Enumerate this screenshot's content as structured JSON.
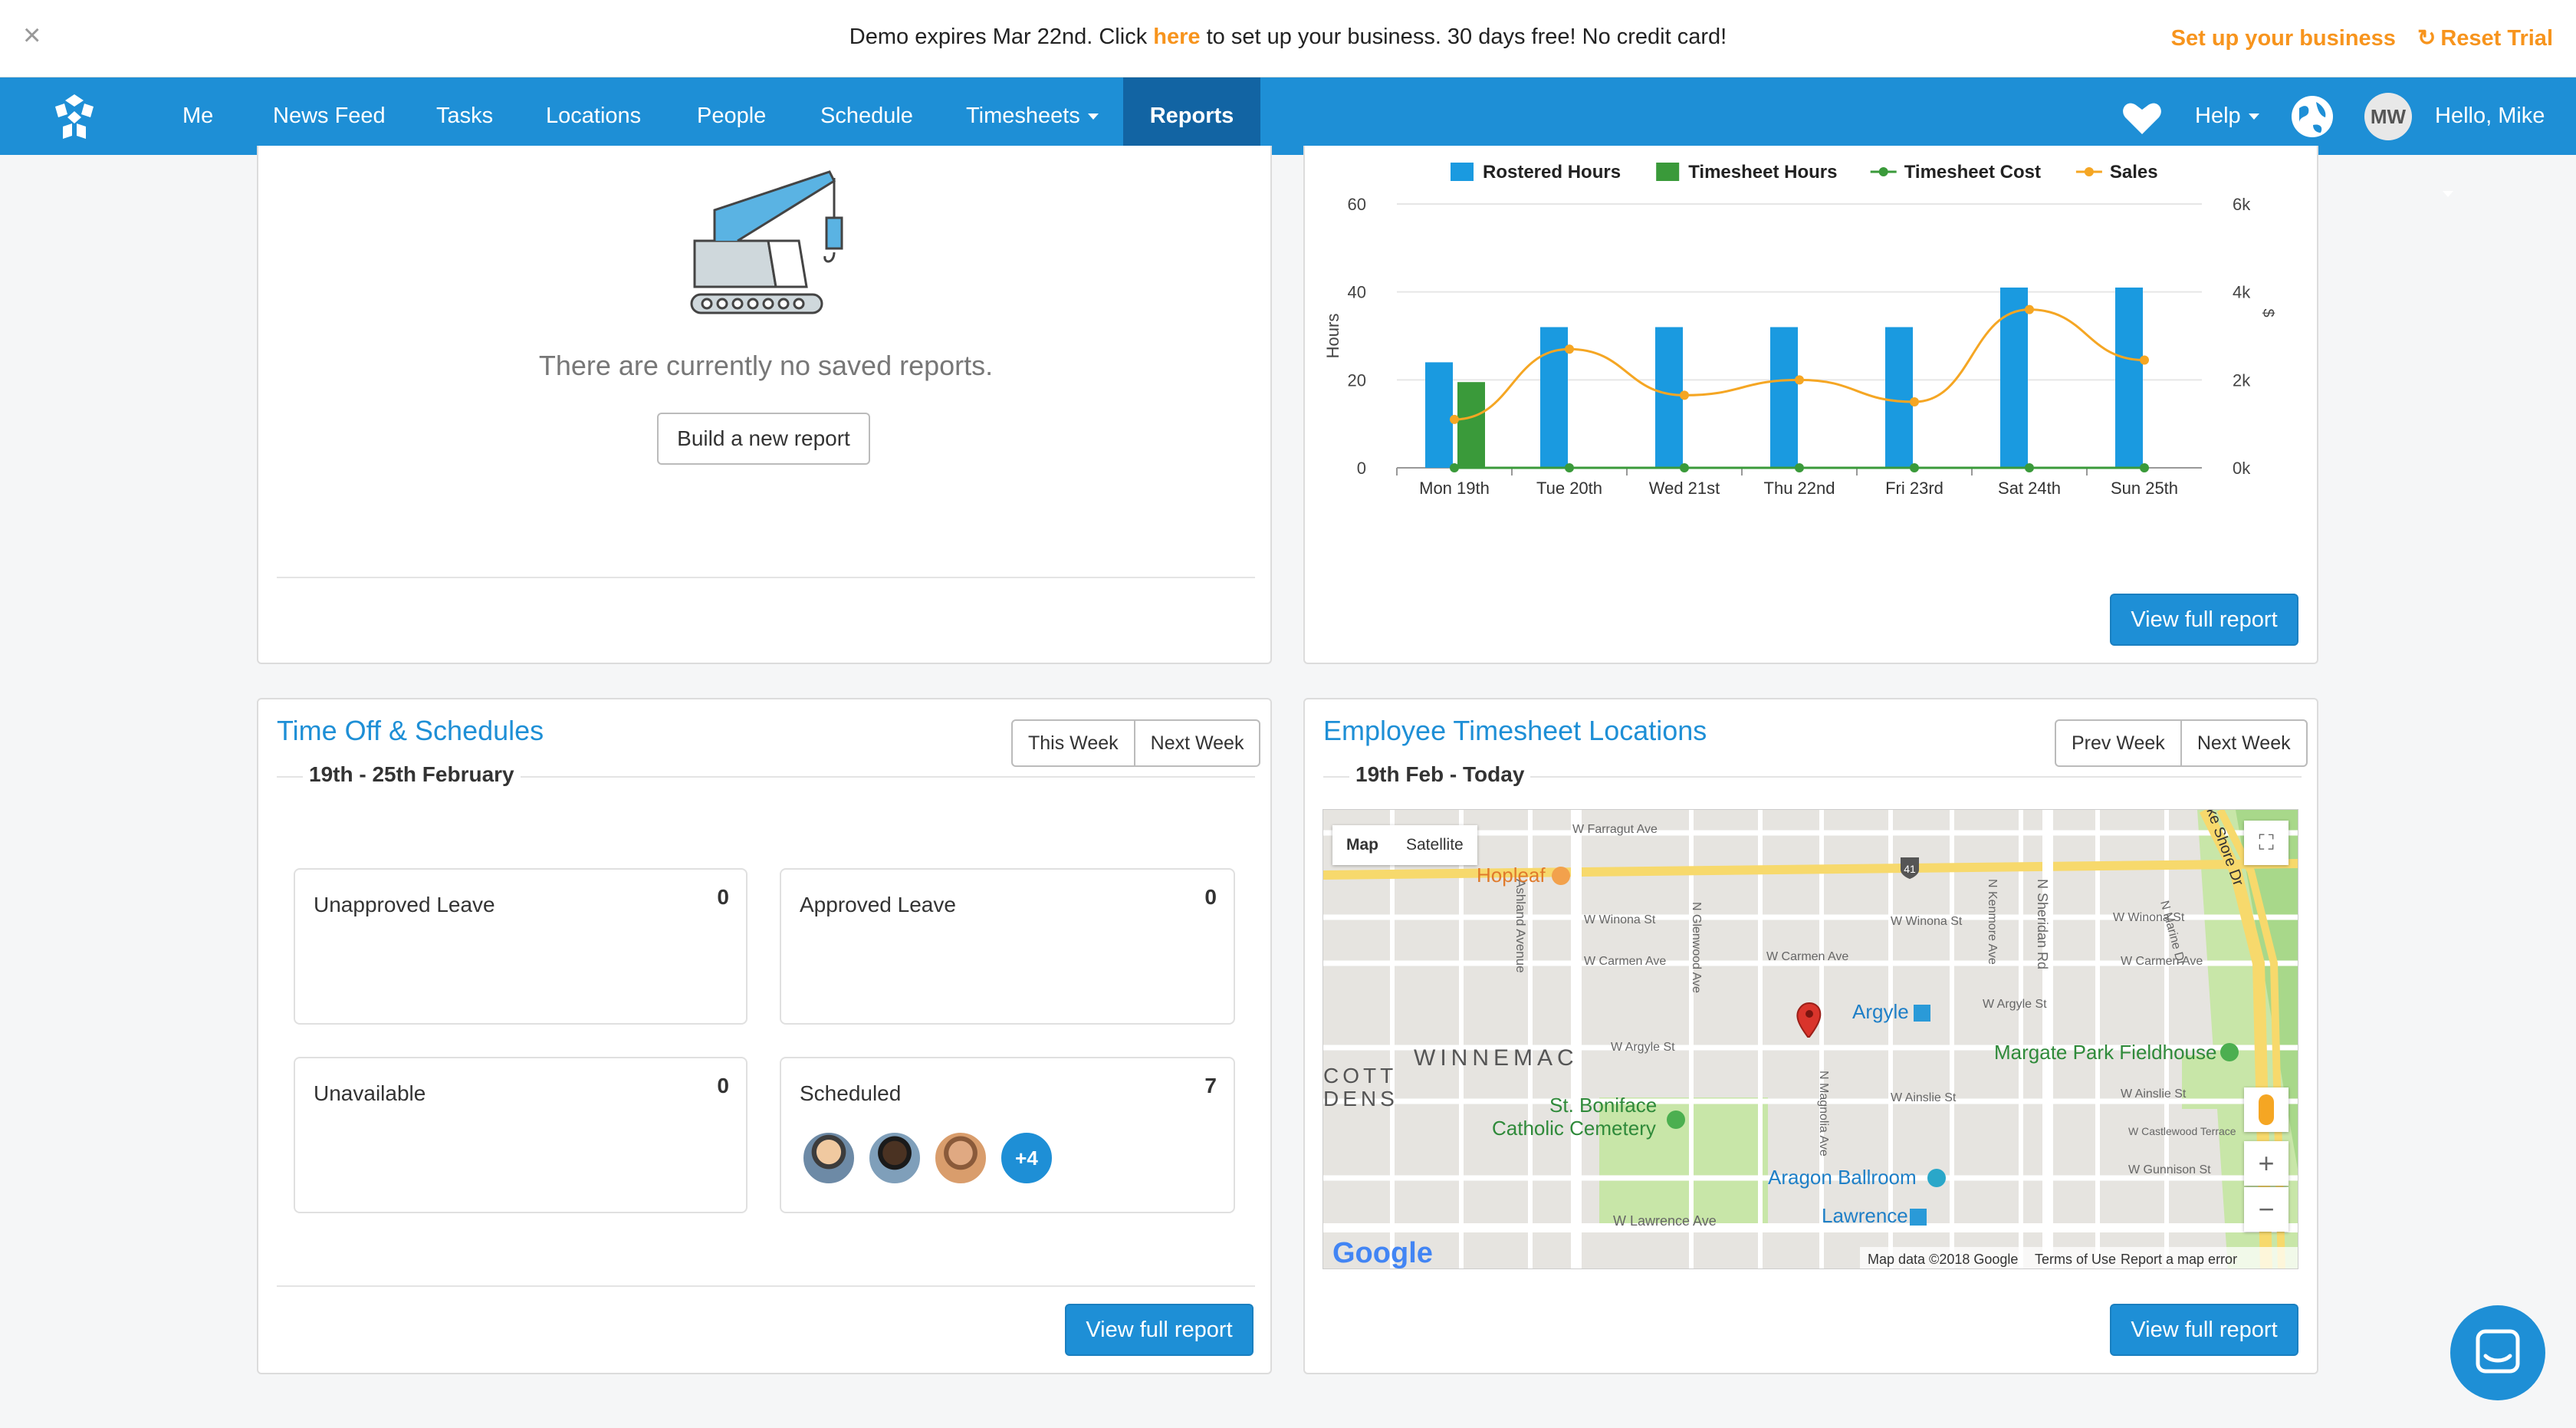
{
  "demo_bar": {
    "msg_before": "Demo expires Mar 22nd. Click ",
    "link": "here",
    "msg_after": " to set up your business. 30 days free! No credit card!",
    "setup": "Set up your business",
    "reset": "Reset Trial"
  },
  "nav": {
    "items": [
      "Me",
      "News Feed",
      "Tasks",
      "Locations",
      "People",
      "Schedule",
      "Timesheets",
      "Reports"
    ],
    "help": "Help",
    "avatar_initials": "MW",
    "greeting": "Hello, Mike"
  },
  "saved_reports": {
    "empty_text": "There are currently no saved reports.",
    "build_button": "Build a new report"
  },
  "hours_panel": {
    "view_full": "View full report"
  },
  "chart_data": {
    "type": "bar",
    "categories": [
      "Mon 19th",
      "Tue 20th",
      "Wed 21st",
      "Thu 22nd",
      "Fri 23rd",
      "Sat 24th",
      "Sun 25th"
    ],
    "series": [
      {
        "name": "Rostered Hours",
        "type": "bar",
        "color": "#1a9ae0",
        "values": [
          24,
          32,
          32,
          32,
          32,
          41,
          41
        ]
      },
      {
        "name": "Timesheet Hours",
        "type": "bar",
        "color": "#3a9a3a",
        "values": [
          19.5,
          0,
          0,
          0,
          0,
          0,
          0
        ]
      },
      {
        "name": "Timesheet Cost",
        "type": "line",
        "color": "#3a9a3a",
        "axis": "right",
        "values": [
          0,
          0,
          0,
          0,
          0,
          0,
          0
        ]
      },
      {
        "name": "Sales",
        "type": "line",
        "color": "#f5a623",
        "axis": "right",
        "values": [
          1100,
          2700,
          1650,
          2000,
          1500,
          3600,
          2450
        ]
      }
    ],
    "ylabel": "Hours",
    "y2label": "$",
    "ylim": [
      0,
      60
    ],
    "y2lim": [
      0,
      6000
    ],
    "yticks": [
      "0",
      "20",
      "40",
      "60"
    ],
    "y2ticks": [
      "0k",
      "2k",
      "4k",
      "6k"
    ],
    "legend_position": "top"
  },
  "time_off": {
    "title": "Time Off & Schedules",
    "this_week": "This Week",
    "next_week": "Next Week",
    "range": "19th - 25th February",
    "cards": [
      {
        "label": "Unapproved Leave",
        "count": "0"
      },
      {
        "label": "Approved Leave",
        "count": "0"
      },
      {
        "label": "Unavailable",
        "count": "0"
      },
      {
        "label": "Scheduled",
        "count": "7"
      }
    ],
    "more": "+4",
    "view_full": "View full report"
  },
  "locations": {
    "title": "Employee Timesheet Locations",
    "prev_week": "Prev Week",
    "next_week": "Next Week",
    "range": "19th Feb - Today",
    "map_tab": "Map",
    "satellite_tab": "Satellite",
    "streets": {
      "farragut": "W Farragut Ave",
      "winona1": "W Winona St",
      "winona2": "W Winona St",
      "winona3": "W Winona St",
      "carmen1": "W Carmen Ave",
      "carmen2": "W Carmen Ave",
      "carmen3": "W Carmen Ave",
      "argyle1": "W Argyle St",
      "argyle2": "W Argyle St",
      "ainslie1": "W Ainslie St",
      "ainslie2": "W Ainslie St",
      "castlewood": "W Castlewood Terrace",
      "gunnison": "W Gunnison St",
      "lawrence": "W Lawrence Ave",
      "ashland": "Ashland Avenue",
      "sheridan": "N Sheridan Rd",
      "glenwood": "N Glenwood Ave",
      "magnolia": "N Magnolia Ave",
      "kenmore": "N Kenmore Ave",
      "marine": "N Marine Dr",
      "shore": "ke Shore Dr",
      "route": "41"
    },
    "places": {
      "hopleaf": "Hopleaf",
      "argyle": "Argyle",
      "margate": "Margate Park Fieldhouse",
      "winnemac": "WINNEMAC",
      "scott1": "COTT",
      "scott2": "DENS",
      "boniface1": "St. Boniface",
      "boniface2": "Catholic Cemetery",
      "aragon": "Aragon Ballroom",
      "lawrence": "Lawrence"
    },
    "google": "Google",
    "map_data": "Map data ©2018 Google",
    "terms": "Terms of Use",
    "report_error": "Report a map error",
    "view_full": "View full report"
  }
}
